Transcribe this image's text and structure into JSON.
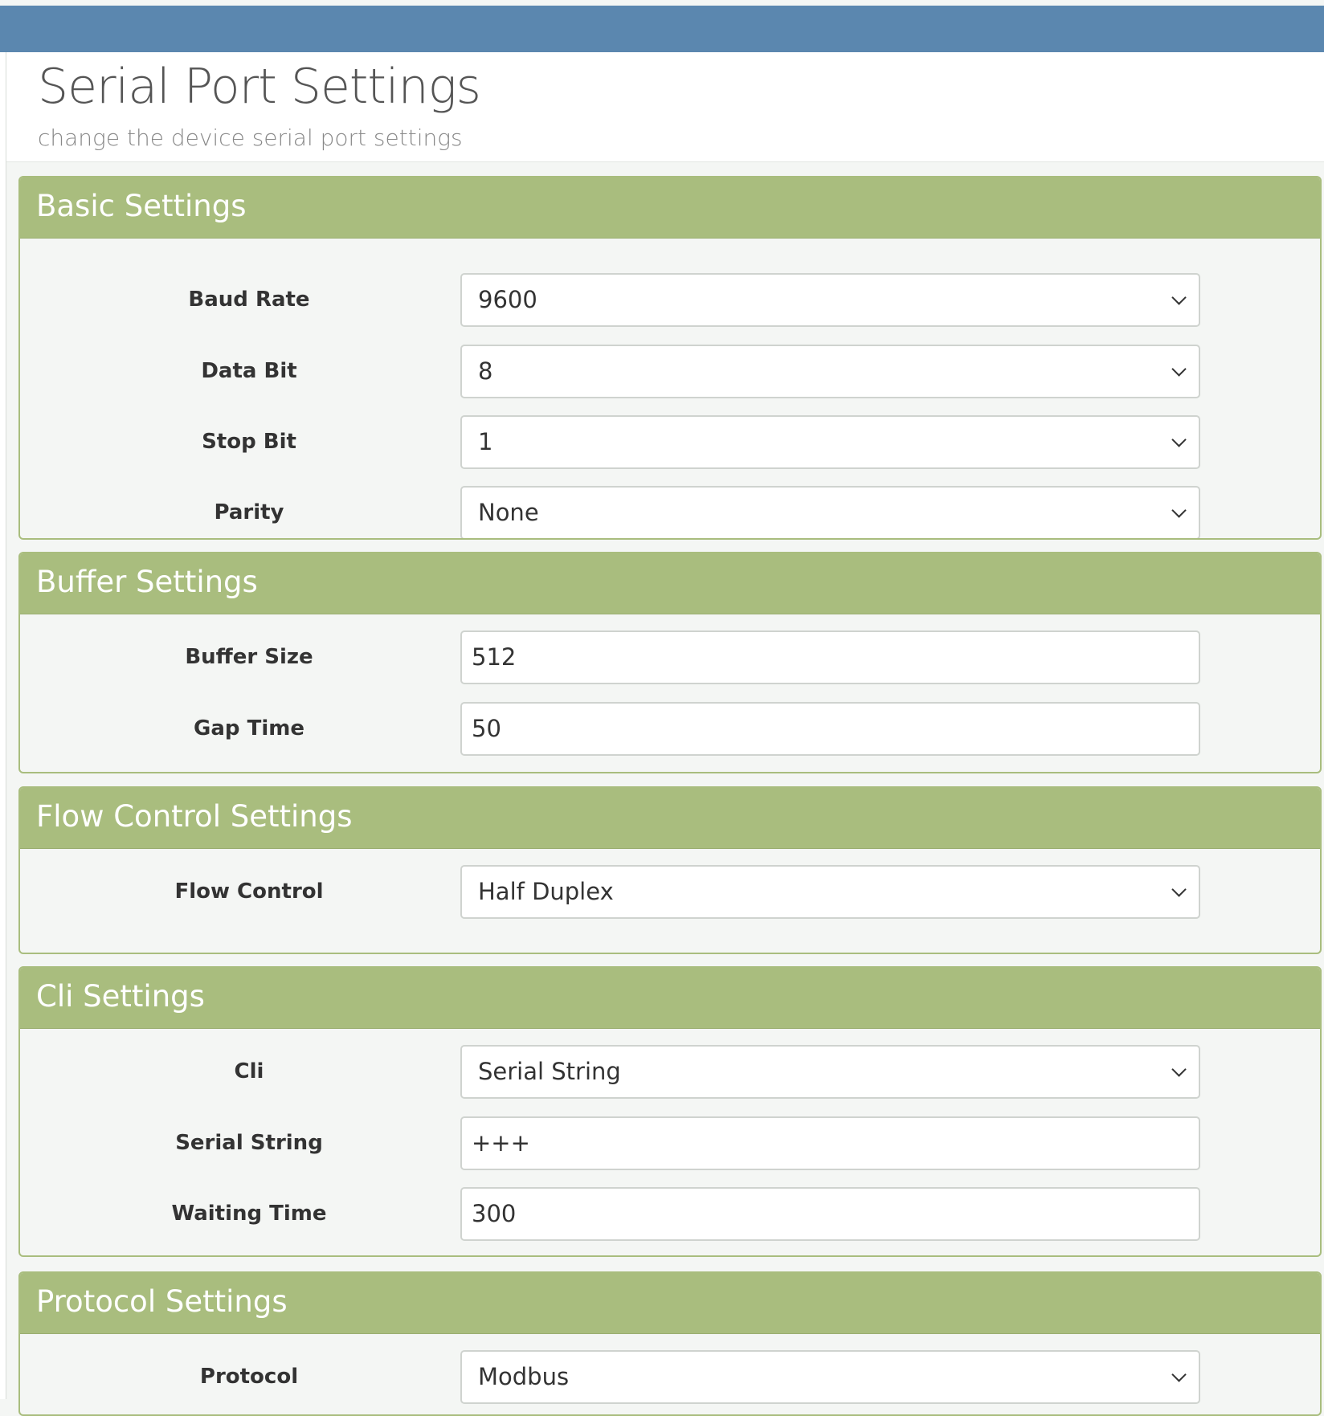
{
  "header": {
    "title": "Serial Port Settings",
    "subtitle": "change the device serial port settings"
  },
  "panels": {
    "basic": {
      "title": "Basic Settings",
      "fields": [
        {
          "label": "Baud Rate",
          "value": "9600",
          "type": "select"
        },
        {
          "label": "Data Bit",
          "value": "8",
          "type": "select"
        },
        {
          "label": "Stop Bit",
          "value": "1",
          "type": "select"
        },
        {
          "label": "Parity",
          "value": "None",
          "type": "select"
        }
      ]
    },
    "buffer": {
      "title": "Buffer Settings",
      "fields": [
        {
          "label": "Buffer Size",
          "value": "512",
          "type": "input"
        },
        {
          "label": "Gap Time",
          "value": "50",
          "type": "input"
        }
      ]
    },
    "flow": {
      "title": "Flow Control Settings",
      "fields": [
        {
          "label": "Flow Control",
          "value": "Half Duplex",
          "type": "select"
        }
      ]
    },
    "cli": {
      "title": "Cli Settings",
      "fields": [
        {
          "label": "Cli",
          "value": "Serial String",
          "type": "select"
        },
        {
          "label": "Serial String",
          "value": "+++",
          "type": "input"
        },
        {
          "label": "Waiting Time",
          "value": "300",
          "type": "input"
        }
      ]
    },
    "protocol": {
      "title": "Protocol Settings",
      "fields": [
        {
          "label": "Protocol",
          "value": "Modbus",
          "type": "select"
        }
      ]
    }
  },
  "icons": {
    "dropdown": "chevron-down-icon"
  },
  "colors": {
    "topbar": "#5b87af",
    "panel_header": "#a9bd7e",
    "panel_border": "#a9bd7e",
    "background": "#f4f6f4"
  }
}
